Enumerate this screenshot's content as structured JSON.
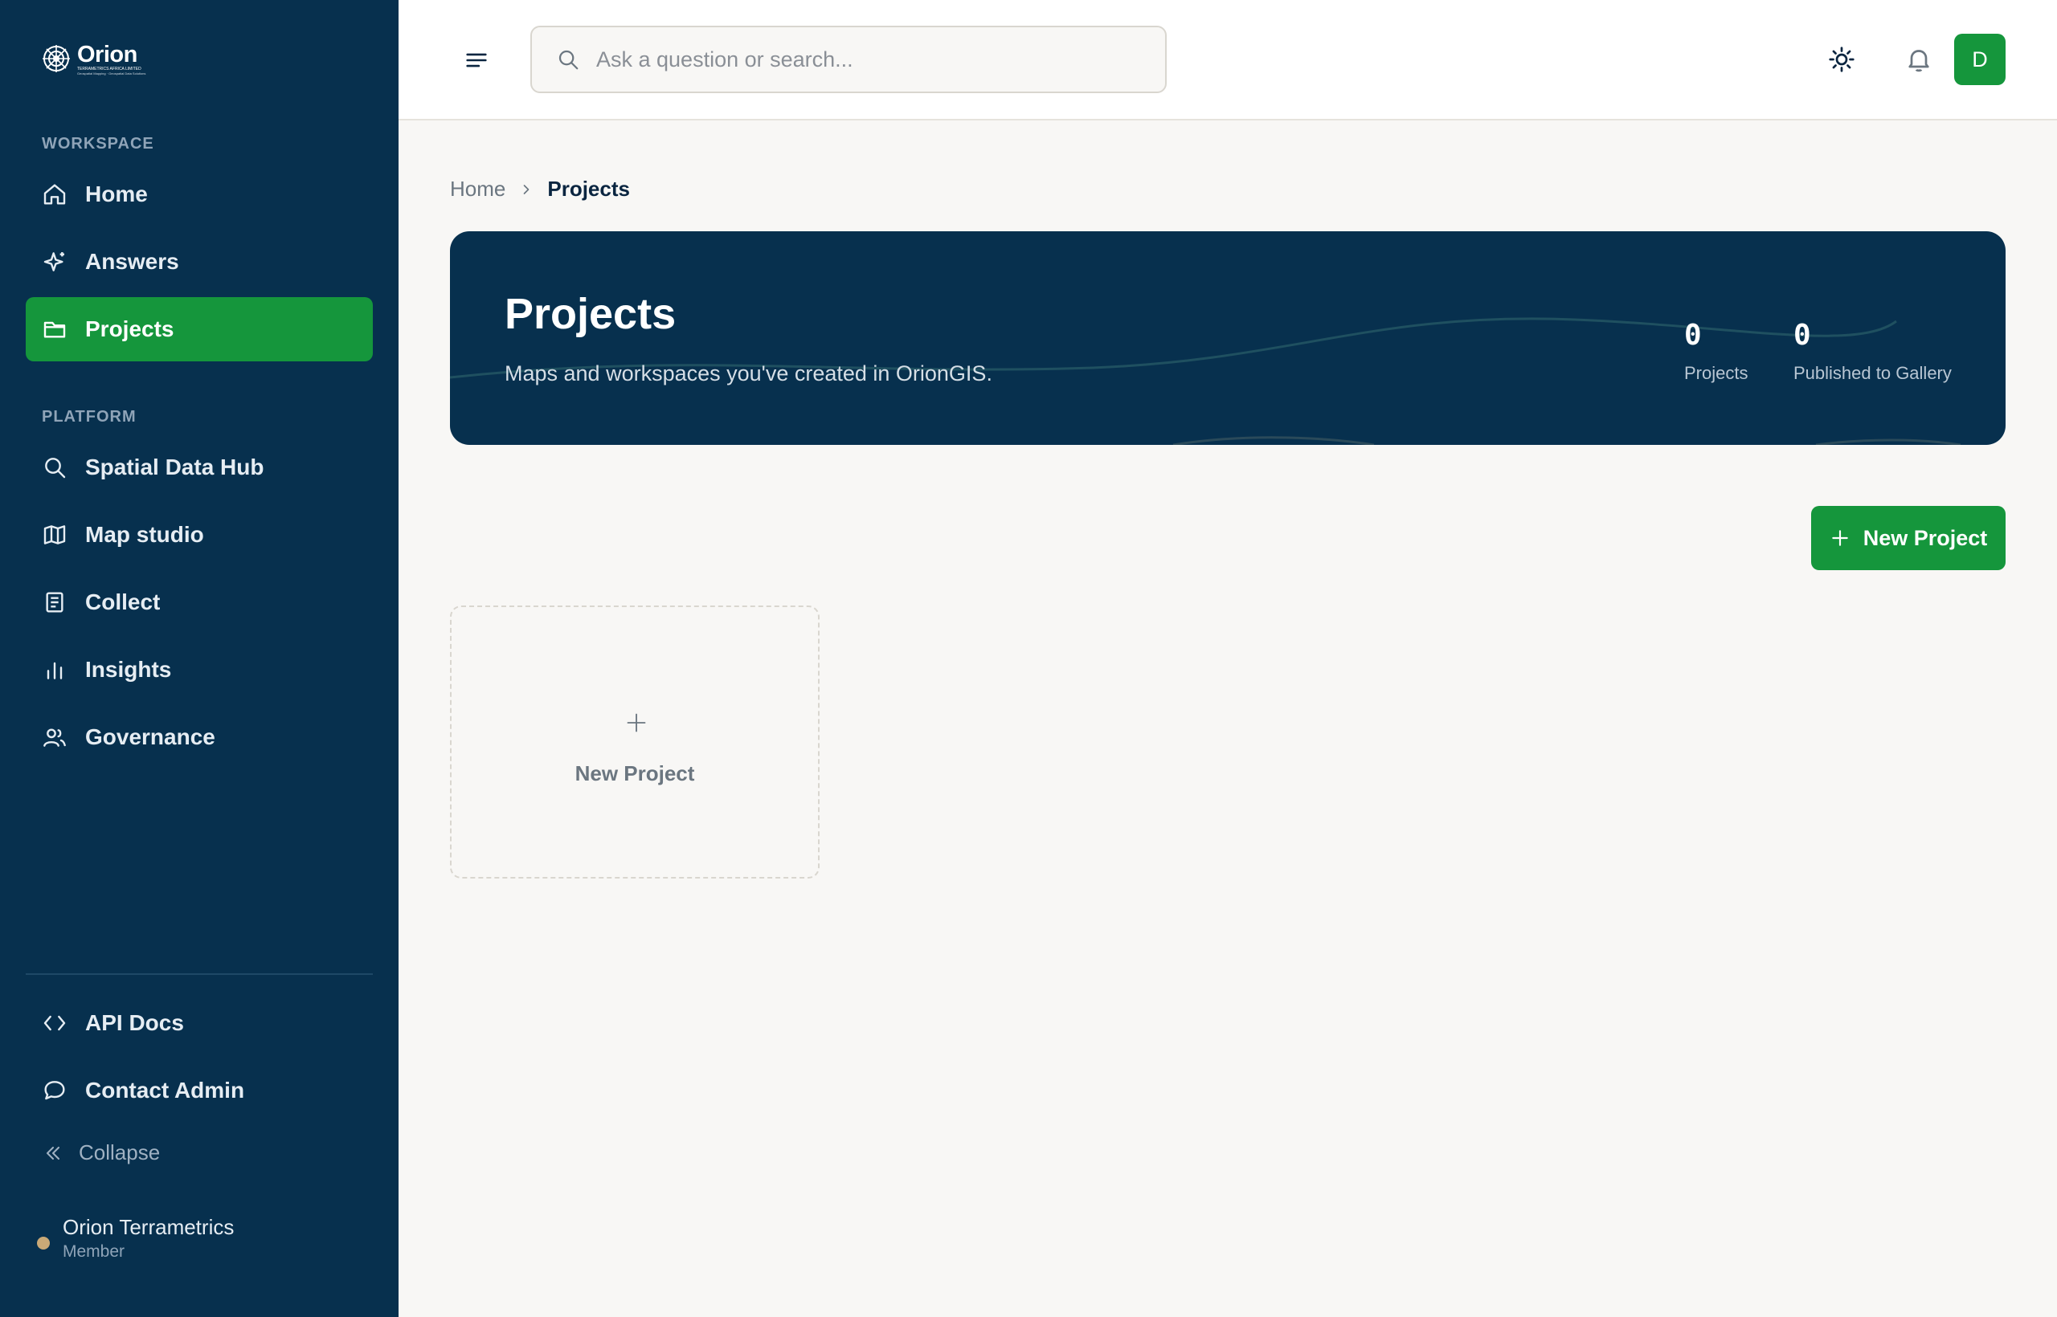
{
  "brand": {
    "name": "Orion",
    "subtitle": "TERRAMETRICS AFRICA LIMITED",
    "tagline": "Geospatial Mapping · Geospatial Data Solutions"
  },
  "sidebar": {
    "workspace_label": "WORKSPACE",
    "platform_label": "PLATFORM",
    "workspace_items": [
      {
        "label": "Home",
        "icon": "home-icon"
      },
      {
        "label": "Answers",
        "icon": "sparkle-icon"
      },
      {
        "label": "Projects",
        "icon": "folder-icon",
        "active": true
      }
    ],
    "platform_items": [
      {
        "label": "Spatial Data Hub",
        "icon": "search-icon"
      },
      {
        "label": "Map studio",
        "icon": "map-icon"
      },
      {
        "label": "Collect",
        "icon": "clipboard-icon"
      },
      {
        "label": "Insights",
        "icon": "bar-chart-icon"
      },
      {
        "label": "Governance",
        "icon": "users-icon"
      }
    ],
    "footer_items": [
      {
        "label": "API Docs",
        "icon": "code-icon"
      },
      {
        "label": "Contact Admin",
        "icon": "chat-icon"
      }
    ],
    "collapse_label": "Collapse",
    "user": {
      "name": "Orion Terrametrics",
      "role": "Member"
    }
  },
  "topbar": {
    "search_placeholder": "Ask a question or search...",
    "avatar_initial": "D"
  },
  "breadcrumb": {
    "home": "Home",
    "current": "Projects"
  },
  "hero": {
    "title": "Projects",
    "subtitle": "Maps and workspaces you've created in OrionGIS.",
    "stats": [
      {
        "value": "0",
        "label": "Projects"
      },
      {
        "value": "0",
        "label": "Published to Gallery"
      }
    ]
  },
  "actions": {
    "new_project_label": "New Project"
  },
  "new_card": {
    "label": "New Project"
  },
  "colors": {
    "sidebar_bg": "#07304e",
    "accent": "#15963c",
    "page_bg": "#f8f7f5"
  }
}
